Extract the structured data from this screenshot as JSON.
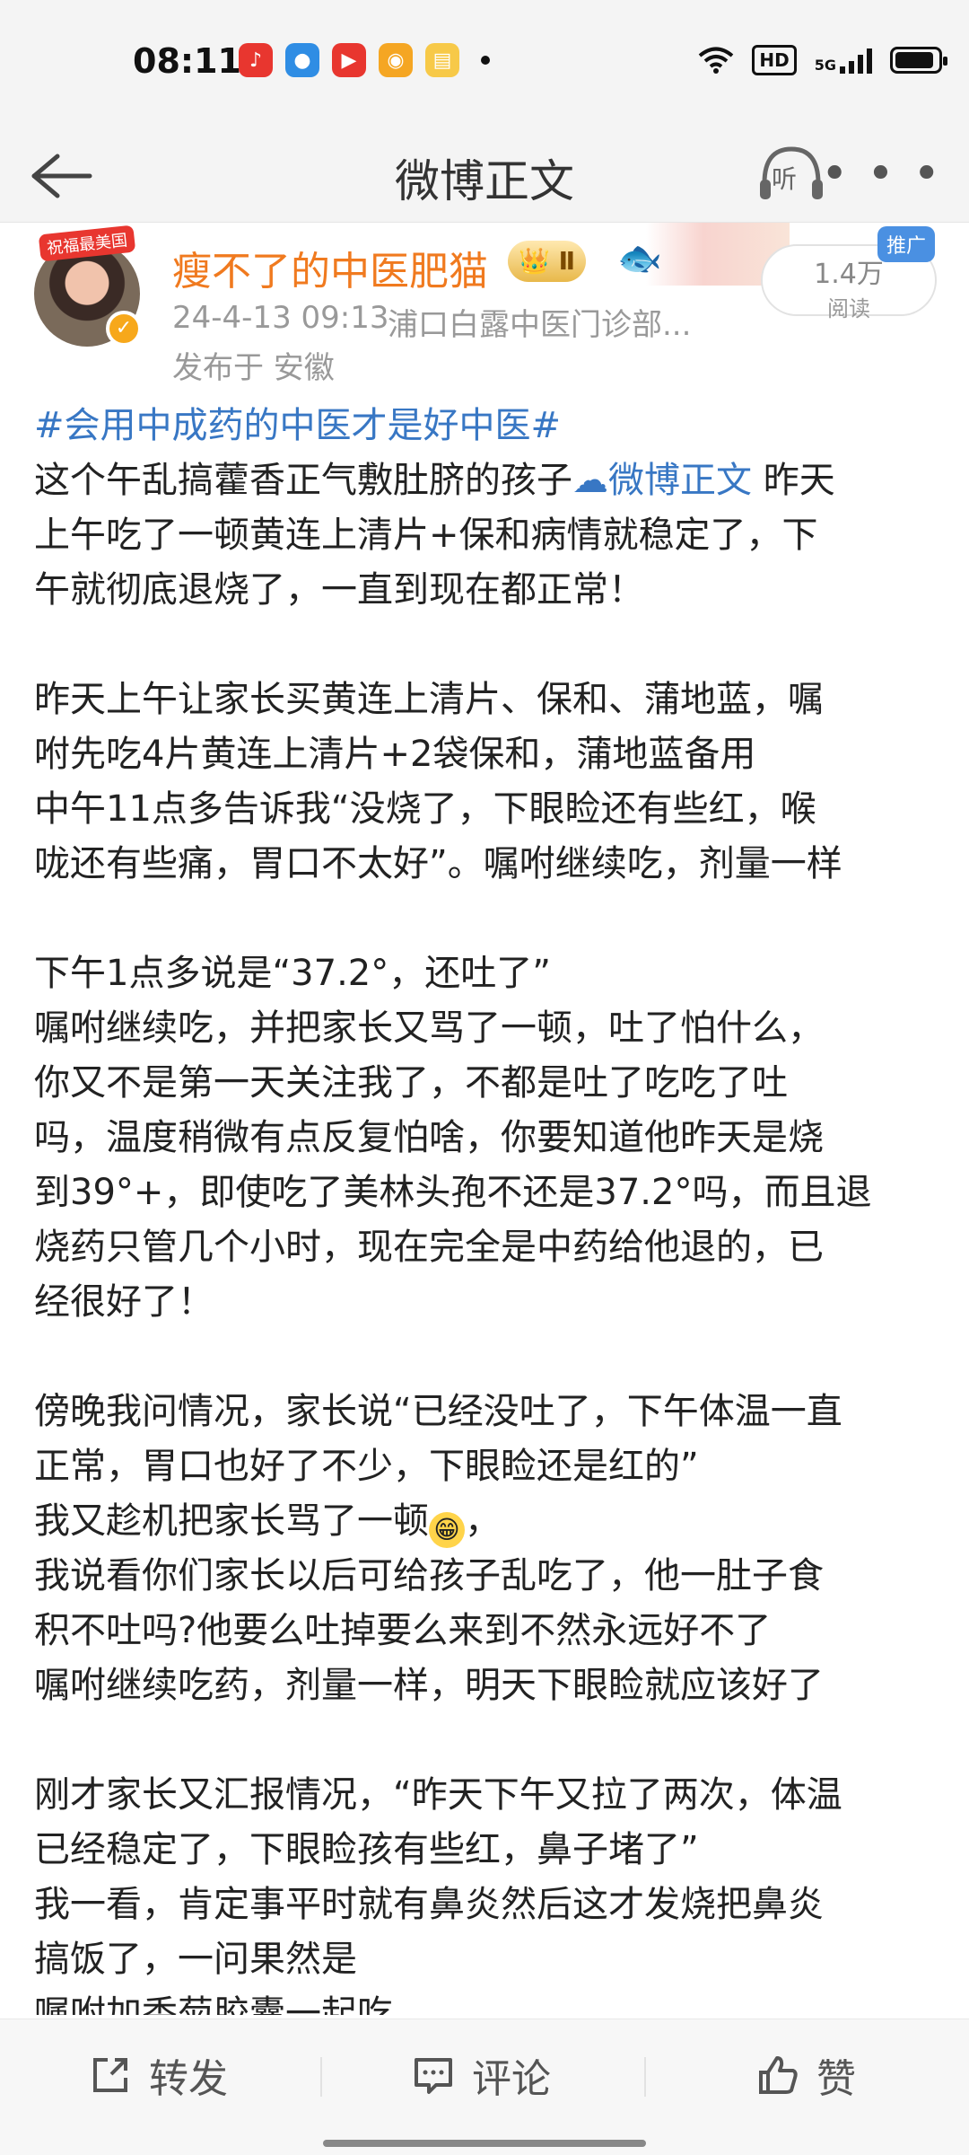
{
  "status_bar": {
    "time": "08:11",
    "hd": "HD",
    "net": "5G"
  },
  "nav": {
    "title": "微博正文",
    "listen_label": "听",
    "more_label": "• • •"
  },
  "post": {
    "author": "瘦不了的中医肥猫",
    "badge": "Ⅱ",
    "avatar_tag": "祝福最美国",
    "timestamp": "24-4-13 09:13",
    "source": "浦口白露中医门诊部...",
    "origin": "发布于 安徽",
    "reads": "1.4万",
    "reads_label": "阅读",
    "promo": "推广",
    "hashtag": "#会用中成药的中医才是好中医#",
    "lines": [
      "这个午乱搞藿香正气敷肚脐的孩子",
      "上午吃了一顿黄连上清片+保和病情就稳定了，下",
      "午就彻底退烧了，一直到现在都正常！",
      "",
      "昨天上午让家长买黄连上清片、保和、蒲地蓝，嘱",
      "咐先吃4片黄连上清片+2袋保和，蒲地蓝备用",
      "中午11点多告诉我“没烧了，下眼睑还有些红，喉",
      "咙还有些痛，胃口不太好”。嘱咐继续吃，剂量一样",
      "",
      "下午1点多说是“37.2°，还吐了”",
      "嘱咐继续吃，并把家长又骂了一顿，吐了怕什么，",
      "你又不是第一天关注我了，不都是吐了吃吃了吐",
      "吗，温度稍微有点反复怕啥，你要知道他昨天是烧",
      "到39°+，即使吃了美林头孢不还是37.2°吗，而且退",
      "烧药只管几个小时，现在完全是中药给他退的，已",
      "经很好了！",
      "",
      "傍晚我问情况，家长说“已经没吐了，下午体温一直",
      "正常，胃口也好了不少，下眼睑还是红的”",
      "我又趁机把家长骂了一顿",
      "我说看你们家长以后可给孩子乱吃了，他一肚子食",
      "积不吐吗?他要么吐掉要么来到不然永远好不了",
      "嘱咐继续吃药，剂量一样，明天下眼睑就应该好了",
      "",
      "刚才家长又汇报情况，“昨天下午又拉了两次，体温",
      "已经稳定了，下眼睑孩有些红，鼻子堵了”",
      "我一看，肯定事平时就有鼻炎然后这才发烧把鼻炎",
      "搞饭了，一问果然是",
      "嘱咐加香菊胶囊一起吃"
    ],
    "inline_link": "微博正文",
    "line1_tail": " 昨天",
    "line20_tail": "，"
  },
  "bottom_bar": {
    "repost": "转发",
    "comment": "评论",
    "like": "赞"
  },
  "colors": {
    "accent_link": "#3877c4",
    "author_name": "#f07a1f"
  }
}
